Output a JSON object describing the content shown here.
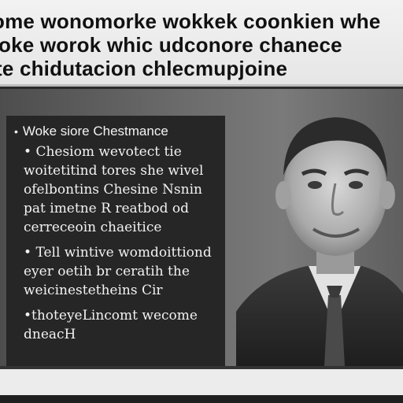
{
  "header": {
    "lines": [
      "ome wonomorke wokkek coonkien whe",
      "oke worok whic udconore chanece",
      "te chidutacion chlecmupjoine"
    ]
  },
  "panel": {
    "heading": {
      "bullet": "•",
      "text": "Woke siore Chestmance"
    },
    "blocks": [
      {
        "bullet": "•",
        "lines": [
          "Chesiom wevotect tie",
          "woitetitind tores she wivel",
          "ofelbontins Chesine Nsnin",
          "pat imetne R reatbod od",
          "cerreceoin chaeitice"
        ]
      },
      {
        "bullet": "•",
        "lines": [
          "Tell wintive womdoittiond",
          "eyer oetih br ceratih the",
          "weicinestetheins Cir"
        ]
      },
      {
        "bullet": "•",
        "lines": [
          "thoteyeLincomt wecome",
          "dneacH"
        ]
      }
    ]
  },
  "colors": {
    "header_bg": "#efefef",
    "panel_bg": "#262626",
    "text_light": "#f2f2f2",
    "text_dark": "#111111"
  }
}
